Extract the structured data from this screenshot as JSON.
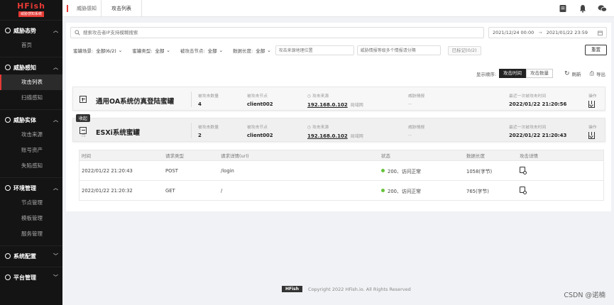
{
  "sidebar": {
    "logo": "HFish",
    "logo_sub": "威胁感知系统",
    "groups": [
      {
        "label": "威胁态势",
        "items": [
          "首页"
        ]
      },
      {
        "label": "威胁感知",
        "items": [
          "攻击列表",
          "扫描感知"
        ]
      },
      {
        "label": "威胁实体",
        "items": [
          "攻击来源",
          "账号资产",
          "失陷感知"
        ]
      },
      {
        "label": "环境管理",
        "items": [
          "节点管理",
          "模板管理",
          "服务管理"
        ]
      },
      {
        "label": "系统配置",
        "items": []
      },
      {
        "label": "平台管理",
        "items": []
      }
    ]
  },
  "topbar": {
    "crumb1": "威胁感知",
    "crumb2": "攻击列表"
  },
  "search": {
    "placeholder": "搜索攻击者IP支持模糊搜索",
    "date_from": "2021/12/24 00:00",
    "date_arrow": "→",
    "date_to": "2021/01/22 23:59"
  },
  "filters": {
    "honeypot_label": "蜜罐场景:",
    "honeypot_value": "全部(6/2)",
    "type_label": "蜜罐类型:",
    "type_value": "全部",
    "node_label": "被攻击节点:",
    "node_value": "全部",
    "length_label": "数据长度:",
    "length_value": "全部",
    "source_placeholder": "攻击来源地理位置",
    "intel_placeholder": "威胁情报等级多个情报请分隔",
    "tag_label": "已标记(0/2)",
    "reset_label": "重置"
  },
  "sort": {
    "label": "显示顺序:",
    "by_time": "攻击时间",
    "by_count": "攻击数量",
    "refresh": "刷新",
    "export": "导出"
  },
  "cards": [
    {
      "name": "通用OA系统仿真登陆蜜罐",
      "count_label": "被攻击数量",
      "count": "4",
      "node_label": "被攻击节点",
      "node": "client002",
      "source_label": "攻击来源",
      "source_ip": "192.168.0.102",
      "source_tag": "局域网",
      "intel_label": "威胁情报",
      "intel": "--",
      "last_label": "最近一次被攻击时间",
      "last": "2022/01/22 21:20:56",
      "op_label": "操作"
    },
    {
      "name": "ESXi系统蜜罐",
      "count_label": "被攻击数量",
      "count": "2",
      "node_label": "被攻击节点",
      "node": "client002",
      "source_label": "攻击来源",
      "source_ip": "192.168.0.102",
      "source_tag": "局域网",
      "intel_label": "威胁情报",
      "intel": "--",
      "last_label": "最近一次被攻击时间",
      "last": "2022/01/22 21:20:43",
      "op_label": "操作"
    }
  ],
  "tooltip": "收起",
  "detail": {
    "headers": [
      "时间",
      "请求类型",
      "请求详情(url)",
      "状态",
      "数据长度",
      "攻击详情"
    ],
    "rows": [
      {
        "time": "2022/01/22 21:20:43",
        "method": "POST",
        "url": "/login",
        "status": "200、访问正常",
        "length": "1058(字节)"
      },
      {
        "time": "2022/01/22 21:20:32",
        "method": "GET",
        "url": "/",
        "status": "200、访问正常",
        "length": "765(字节)"
      }
    ]
  },
  "footer": {
    "logo": "HFish",
    "copyright": "Copyright 2022 HFish.io. All Rights Reserved"
  },
  "watermark": "CSDN @诺楠"
}
